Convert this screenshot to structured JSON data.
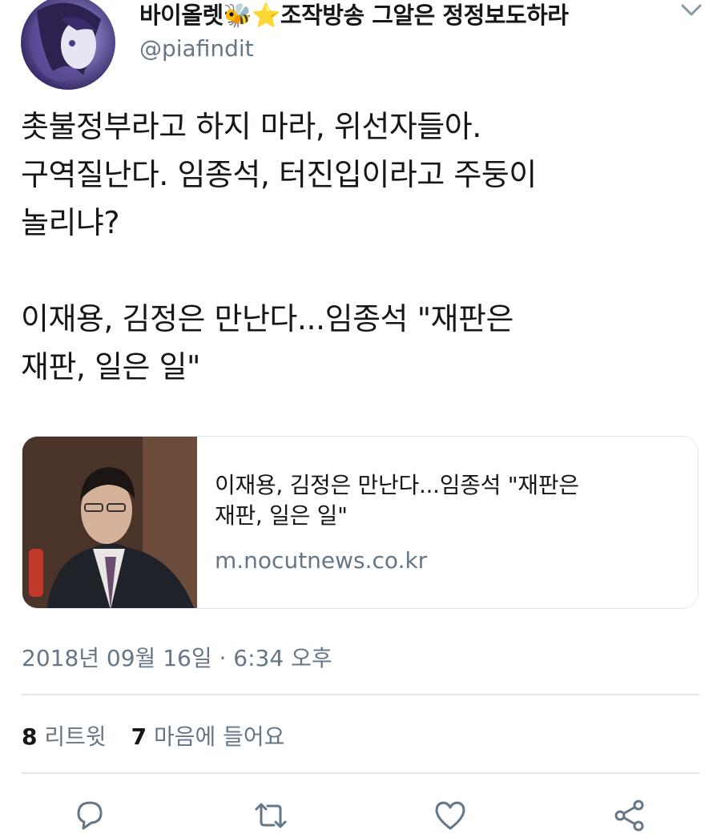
{
  "user": {
    "display_name": "바이올렛🐝⭐조작방송 그알은 정정보도하라",
    "handle": "@piafindit"
  },
  "tweet": {
    "line1": "촛불정부라고 하지 마라, 위선자들아.",
    "line2": "구역질난다. 임종석, 터진입이라고 주둥이",
    "line3": "놀리냐?",
    "line4": "이재용, 김정은 만난다...임종석 \"재판은",
    "line5": "재판, 일은 일\""
  },
  "card": {
    "title_line1": "이재용, 김정은 만난다...임종석 \"재판은",
    "title_line2": "재판, 일은 일\"",
    "domain": "m.nocutnews.co.kr"
  },
  "timestamp": "2018년 09월 16일 · 6:34 오후",
  "stats": {
    "retweet_count": "8",
    "retweet_label": "리트윗",
    "like_count": "7",
    "like_label": "마음에 들어요"
  },
  "icons": {
    "reply": "reply-icon",
    "retweet": "retweet-icon",
    "like": "heart-icon",
    "share": "share-icon",
    "caret": "chevron-down-icon"
  },
  "colors": {
    "text": "#14171a",
    "secondary": "#657786",
    "border": "#e1e8ed"
  }
}
